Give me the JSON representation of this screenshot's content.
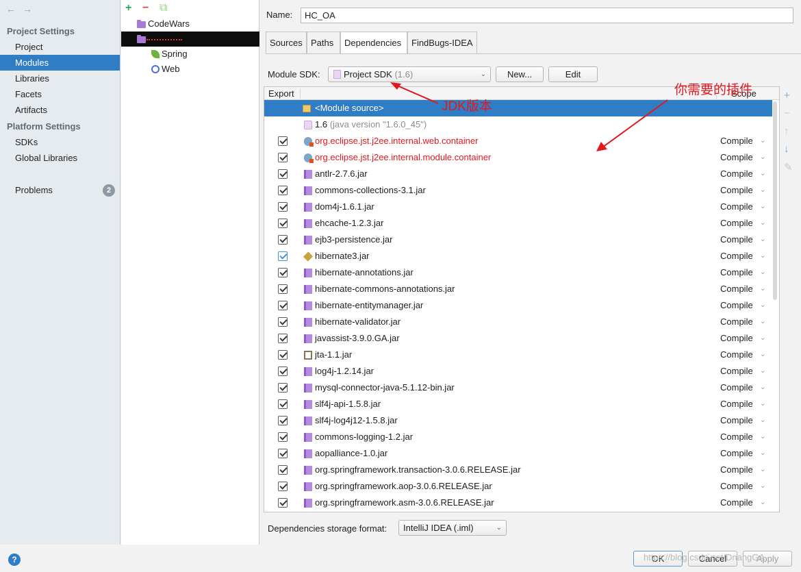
{
  "nav": {
    "back_icon": "←",
    "forward_icon": "→",
    "project_settings": "Project Settings",
    "project_items": [
      "Project",
      "Modules",
      "Libraries",
      "Facets",
      "Artifacts"
    ],
    "platform_settings": "Platform Settings",
    "platform_items": [
      "SDKs",
      "Global Libraries"
    ],
    "problems": "Problems",
    "problems_count": "2"
  },
  "tree": {
    "add": "+",
    "remove": "−",
    "copy": "⧉",
    "items": [
      "CodeWars",
      "Spring",
      "Web"
    ]
  },
  "module": {
    "name_label": "Name:",
    "name_value": "HC_OA",
    "tabs": [
      "Sources",
      "Paths",
      "Dependencies",
      "FindBugs-IDEA"
    ],
    "sdk_label": "Module SDK:",
    "sdk_value": "Project SDK",
    "sdk_version": "(1.6)",
    "new_button": "New...",
    "edit_button": "Edit"
  },
  "table": {
    "col_export": "Export",
    "col_scope": "Scope",
    "module_source": "<Module source>",
    "jdk_name": "1.6",
    "jdk_version": "(java version \"1.6.0_45\")",
    "scope_value": "Compile",
    "deps": [
      {
        "name": "org.eclipse.jst.j2ee.internal.web.container",
        "kind": "web",
        "red": true,
        "checked_style": "dark"
      },
      {
        "name": "org.eclipse.jst.j2ee.internal.module.container",
        "kind": "web",
        "red": true,
        "checked_style": "dark"
      },
      {
        "name": "antlr-2.7.6.jar",
        "kind": "jar"
      },
      {
        "name": "commons-collections-3.1.jar",
        "kind": "jar"
      },
      {
        "name": "dom4j-1.6.1.jar",
        "kind": "jar"
      },
      {
        "name": "ehcache-1.2.3.jar",
        "kind": "jar"
      },
      {
        "name": "ejb3-persistence.jar",
        "kind": "jar"
      },
      {
        "name": "hibernate3.jar",
        "kind": "hibernate",
        "checked_style": "blue"
      },
      {
        "name": "hibernate-annotations.jar",
        "kind": "jar"
      },
      {
        "name": "hibernate-commons-annotations.jar",
        "kind": "jar"
      },
      {
        "name": "hibernate-entitymanager.jar",
        "kind": "jar"
      },
      {
        "name": "hibernate-validator.jar",
        "kind": "jar"
      },
      {
        "name": "javassist-3.9.0.GA.jar",
        "kind": "jar"
      },
      {
        "name": "jta-1.1.jar",
        "kind": "jta"
      },
      {
        "name": "log4j-1.2.14.jar",
        "kind": "jar"
      },
      {
        "name": "mysql-connector-java-5.1.12-bin.jar",
        "kind": "jar"
      },
      {
        "name": "slf4j-api-1.5.8.jar",
        "kind": "jar"
      },
      {
        "name": "slf4j-log4j12-1.5.8.jar",
        "kind": "jar"
      },
      {
        "name": "commons-logging-1.2.jar",
        "kind": "jar"
      },
      {
        "name": "aopalliance-1.0.jar",
        "kind": "jar"
      },
      {
        "name": "org.springframework.transaction-3.0.6.RELEASE.jar",
        "kind": "jar"
      },
      {
        "name": "org.springframework.aop-3.0.6.RELEASE.jar",
        "kind": "jar"
      },
      {
        "name": "org.springframework.asm-3.0.6.RELEASE.jar",
        "kind": "jar"
      }
    ]
  },
  "side_buttons": [
    "+",
    "−",
    "↑",
    "↓",
    "✎"
  ],
  "storage": {
    "label": "Dependencies storage format:",
    "value": "IntelliJ IDEA (.iml)"
  },
  "annotations": {
    "jdk": "JDK版本",
    "plugins": "你需要的插件"
  },
  "footer": {
    "help": "?",
    "ok": "OK",
    "cancel": "Cancel",
    "apply": "Apply",
    "watermark": "https://blog.csdn.net/DnangGA"
  },
  "colors": {
    "selection": "#2e7dc5",
    "annotation_red": "#e5171c"
  }
}
